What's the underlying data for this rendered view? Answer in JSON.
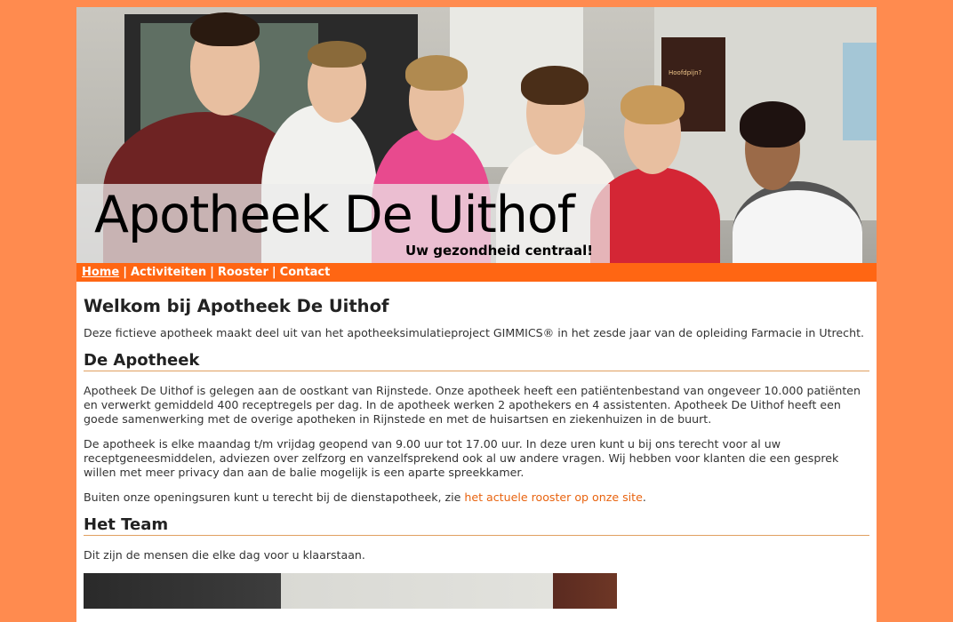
{
  "header": {
    "title": "Apotheek De Uithof",
    "tagline": "Uw gezondheid centraal!",
    "poster_text": [
      "Hoofdpijn?"
    ]
  },
  "nav": {
    "items": [
      {
        "label": "Home",
        "active": true
      },
      {
        "label": "Activiteiten",
        "active": false
      },
      {
        "label": "Rooster",
        "active": false
      },
      {
        "label": "Contact",
        "active": false
      }
    ],
    "separator": "|"
  },
  "main": {
    "heading": "Welkom bij Apotheek De Uithof",
    "intro": "Deze fictieve apotheek maakt deel uit van het apotheeksimulatieproject GIMMICS® in het zesde jaar van de opleiding Farmacie in Utrecht.",
    "sections": [
      {
        "heading": "De Apotheek",
        "paragraphs": [
          "Apotheek De Uithof is gelegen aan de oostkant van Rijnstede. Onze apotheek heeft een patiëntenbestand van ongeveer 10.000 patiënten en verwerkt gemiddeld 400 receptregels per dag. In de apotheek werken 2 apothekers en 4 assistenten. Apotheek De Uithof heeft een goede samenwerking met de overige apotheken in Rijnstede en met de huisartsen en ziekenhuizen in de buurt.",
          "De apotheek is elke maandag t/m vrijdag geopend van 9.00 uur tot 17.00 uur. In deze uren kunt u bij ons terecht voor al uw receptgeneesmiddelen, adviezen over zelfzorg en vanzelfsprekend ook al uw andere vragen. Wij hebben voor klanten die een gesprek willen met meer privacy dan aan de balie mogelijk is een aparte spreekkamer."
        ],
        "link_paragraph": {
          "before": "Buiten onze openingsuren kunt u terecht bij de dienstapotheek, zie ",
          "link": "het actuele rooster op onze site",
          "after": "."
        }
      },
      {
        "heading": "Het Team",
        "paragraphs": [
          "Dit zijn de mensen die elke dag voor u klaarstaan."
        ]
      }
    ]
  },
  "colors": {
    "background": "#ff8b4f",
    "nav": "#ff6613",
    "link": "#e8630f",
    "rule": "#e0a060"
  }
}
